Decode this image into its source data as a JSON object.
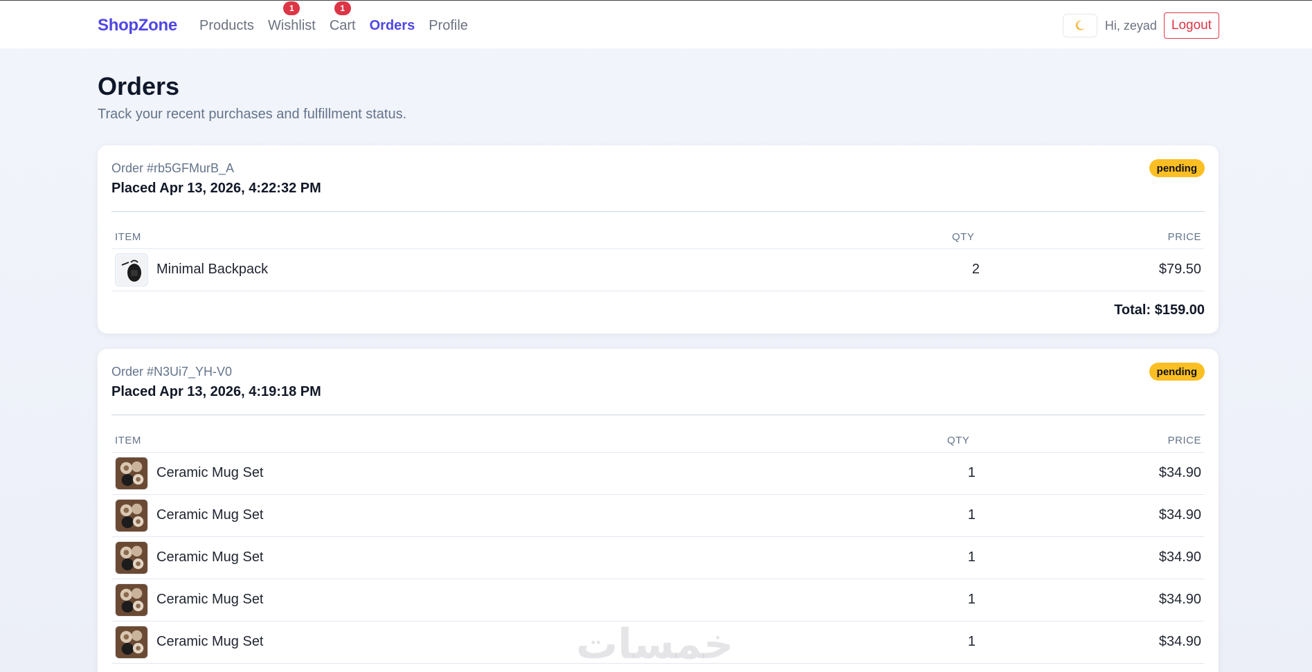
{
  "nav": {
    "brand": "ShopZone",
    "links": [
      {
        "label": "Products",
        "badge": null,
        "active": false
      },
      {
        "label": "Wishlist",
        "badge": "1",
        "active": false
      },
      {
        "label": "Cart",
        "badge": "1",
        "active": false
      },
      {
        "label": "Orders",
        "badge": null,
        "active": true
      },
      {
        "label": "Profile",
        "badge": null,
        "active": false
      }
    ],
    "theme_icon": "moon-icon",
    "greeting": "Hi, zeyad",
    "logout_label": "Logout"
  },
  "page": {
    "title": "Orders",
    "subtitle": "Track your recent purchases and fulfillment status."
  },
  "table_headers": {
    "item": "ITEM",
    "qty": "QTY",
    "price": "PRICE"
  },
  "orders": [
    {
      "id": "Order #rb5GFMurB_A",
      "placed": "Placed Apr 13, 2026, 4:22:32 PM",
      "status": "pending",
      "items": [
        {
          "name": "Minimal Backpack",
          "qty": "2",
          "price": "$79.50",
          "thumb": "backpack"
        }
      ],
      "total": "Total: $159.00"
    },
    {
      "id": "Order #N3Ui7_YH-V0",
      "placed": "Placed Apr 13, 2026, 4:19:18 PM",
      "status": "pending",
      "items": [
        {
          "name": "Ceramic Mug Set",
          "qty": "1",
          "price": "$34.90",
          "thumb": "mugs"
        },
        {
          "name": "Ceramic Mug Set",
          "qty": "1",
          "price": "$34.90",
          "thumb": "mugs"
        },
        {
          "name": "Ceramic Mug Set",
          "qty": "1",
          "price": "$34.90",
          "thumb": "mugs"
        },
        {
          "name": "Ceramic Mug Set",
          "qty": "1",
          "price": "$34.90",
          "thumb": "mugs"
        },
        {
          "name": "Ceramic Mug Set",
          "qty": "1",
          "price": "$34.90",
          "thumb": "mugs"
        }
      ]
    }
  ],
  "colors": {
    "accent": "#4f46e5",
    "danger": "#dc3545",
    "pending": "#fbbf24"
  },
  "watermark": "خمسات"
}
